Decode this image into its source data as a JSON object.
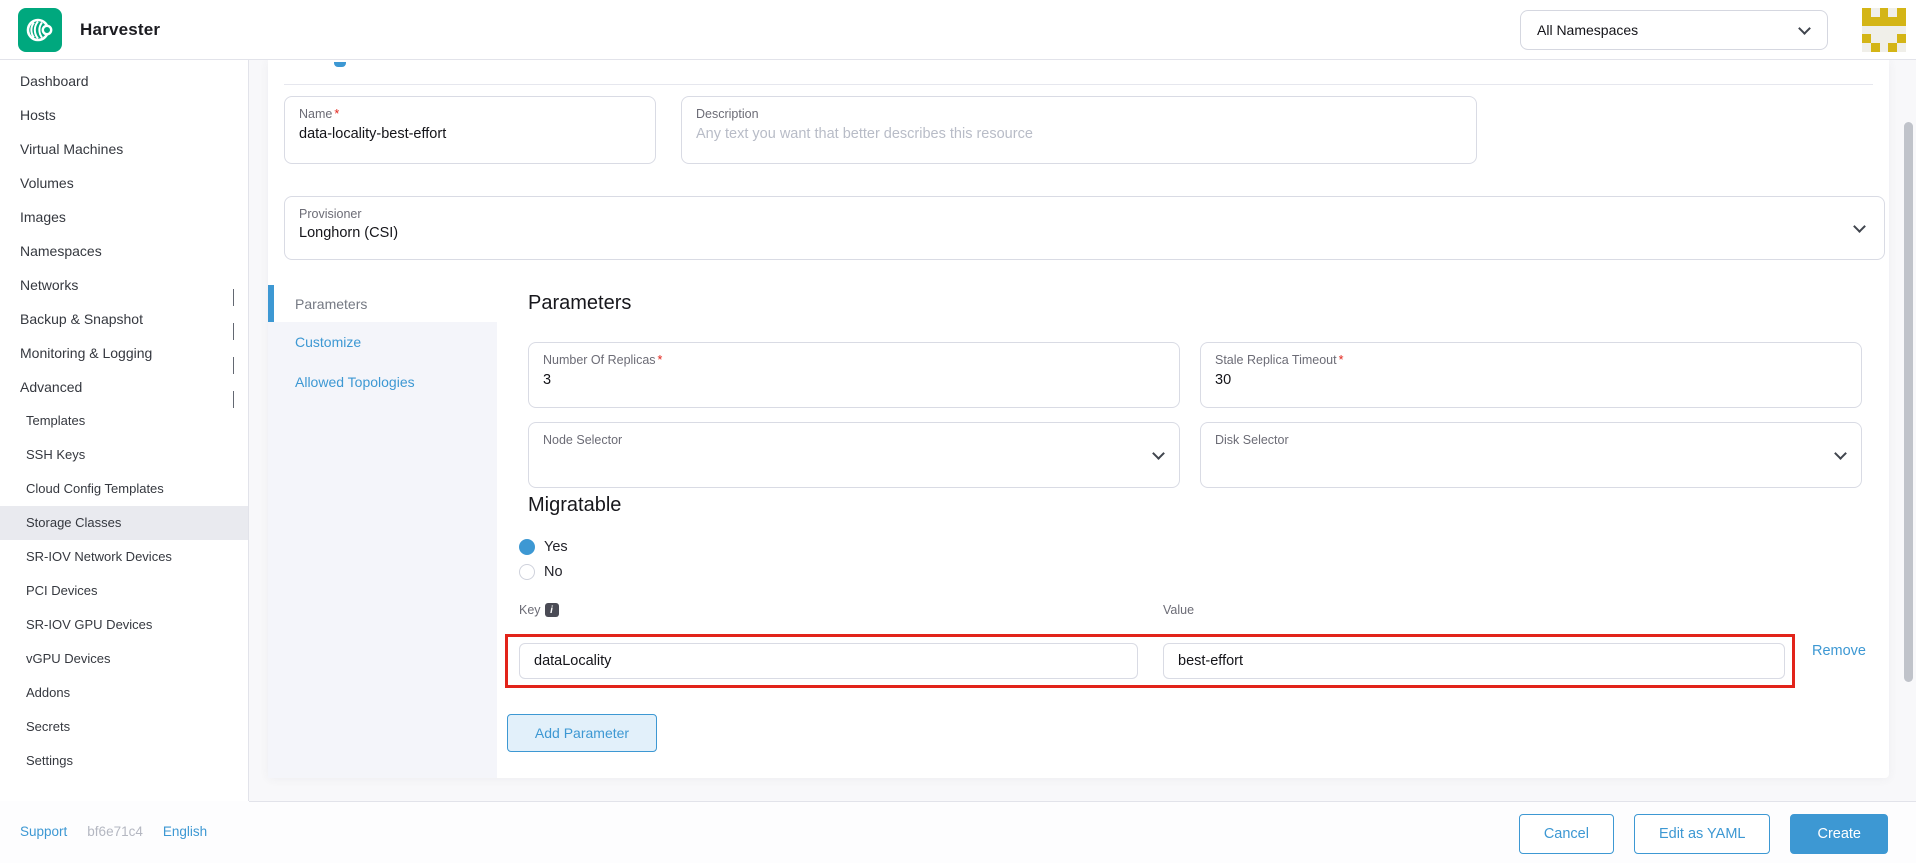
{
  "header": {
    "app_title": "Harvester",
    "namespace_selector": {
      "selected": "All Namespaces"
    }
  },
  "sidebar": {
    "items": [
      {
        "label": "Dashboard"
      },
      {
        "label": "Hosts"
      },
      {
        "label": "Virtual Machines"
      },
      {
        "label": "Volumes"
      },
      {
        "label": "Images"
      },
      {
        "label": "Namespaces"
      },
      {
        "label": "Networks",
        "chevron": "down"
      },
      {
        "label": "Backup & Snapshot",
        "chevron": "down"
      },
      {
        "label": "Monitoring & Logging",
        "chevron": "down"
      },
      {
        "label": "Advanced",
        "chevron": "up"
      },
      {
        "label": "Templates",
        "sub": true
      },
      {
        "label": "SSH Keys",
        "sub": true
      },
      {
        "label": "Cloud Config Templates",
        "sub": true
      },
      {
        "label": "Storage Classes",
        "sub": true,
        "selected": true
      },
      {
        "label": "SR-IOV Network Devices",
        "sub": true
      },
      {
        "label": "PCI Devices",
        "sub": true
      },
      {
        "label": "SR-IOV GPU Devices",
        "sub": true
      },
      {
        "label": "vGPU Devices",
        "sub": true
      },
      {
        "label": "Addons",
        "sub": true
      },
      {
        "label": "Secrets",
        "sub": true
      },
      {
        "label": "Settings",
        "sub": true
      }
    ]
  },
  "form": {
    "required_mark": "*",
    "name": {
      "label": "Name",
      "value": "data-locality-best-effort"
    },
    "description": {
      "label": "Description",
      "placeholder": "Any text you want that better describes this resource"
    },
    "provisioner": {
      "label": "Provisioner",
      "value": "Longhorn (CSI)"
    },
    "tabs": {
      "parameters": "Parameters",
      "customize": "Customize",
      "allowed_topologies": "Allowed Topologies"
    },
    "parameters_section": {
      "heading": "Parameters",
      "number_of_replicas": {
        "label": "Number Of Replicas",
        "value": "3"
      },
      "stale_replica_timeout": {
        "label": "Stale Replica Timeout",
        "value": "30"
      },
      "node_selector": {
        "label": "Node Selector"
      },
      "disk_selector": {
        "label": "Disk Selector"
      },
      "migratable": {
        "heading": "Migratable",
        "option_yes": "Yes",
        "option_no": "No",
        "selected": "Yes"
      },
      "kv_row": {
        "key_label": "Key",
        "value_label": "Value",
        "key_value": "dataLocality",
        "value_value": "best-effort",
        "remove_label": "Remove"
      },
      "add_button": "Add Parameter"
    }
  },
  "footer": {
    "support": "Support",
    "build_hash": "bf6e71c4",
    "language": "English",
    "actions": {
      "cancel": "Cancel",
      "edit_yaml": "Edit as YAML",
      "create": "Create"
    }
  },
  "icons": {
    "logo": "harvester-wheel",
    "namespace_chevron": "chevron-down",
    "avatar": "pixel-identicon",
    "key_info": "info-tooltip"
  },
  "colors": {
    "accent_blue": "#3d98d3",
    "brand_green": "#00a87e",
    "highlight_red": "#e2231a",
    "avatar_gold": "#d4b516",
    "selected_nav_bg": "#e9eaef",
    "tab_panel_bg": "#f4f5fa"
  }
}
